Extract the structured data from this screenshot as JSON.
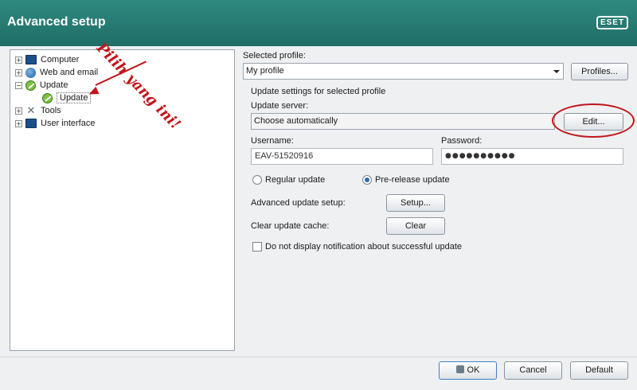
{
  "window": {
    "title": "Advanced setup",
    "logo": "ESET"
  },
  "tree": {
    "items": [
      {
        "label": "Computer",
        "icon": "computer-icon",
        "expander": "+"
      },
      {
        "label": "Web and email",
        "icon": "web-icon",
        "expander": "+"
      },
      {
        "label": "Update",
        "icon": "update-icon",
        "expander": "−"
      },
      {
        "label": "Update",
        "icon": "update-icon"
      },
      {
        "label": "Tools",
        "icon": "tools-icon",
        "expander": "+"
      },
      {
        "label": "User interface",
        "icon": "user-interface-icon",
        "expander": "+"
      }
    ],
    "selected": "Update"
  },
  "annotation": {
    "text": "Pilih yang ini!",
    "color": "#c0161b"
  },
  "profile": {
    "label": "Selected profile:",
    "value": "My profile",
    "button": "Profiles..."
  },
  "settings": {
    "section_label": "Update settings for selected profile",
    "server_label": "Update server:",
    "server_value": "Choose automatically",
    "edit_button": "Edit...",
    "username_label": "Username:",
    "username_value": "EAV-51520916",
    "password_label": "Password:",
    "password_value": "●●●●●●●●●●",
    "regular_update": "Regular update",
    "prerelease_update": "Pre-release update",
    "advanced_label": "Advanced update setup:",
    "setup_button": "Setup...",
    "clear_label": "Clear update cache:",
    "clear_button": "Clear",
    "notification_checkbox": "Do not display notification about successful update"
  },
  "footer": {
    "ok": "OK",
    "cancel": "Cancel",
    "default": "Default"
  },
  "colors": {
    "titlebar": "#2a7f76",
    "accent_red": "#c0161b"
  }
}
